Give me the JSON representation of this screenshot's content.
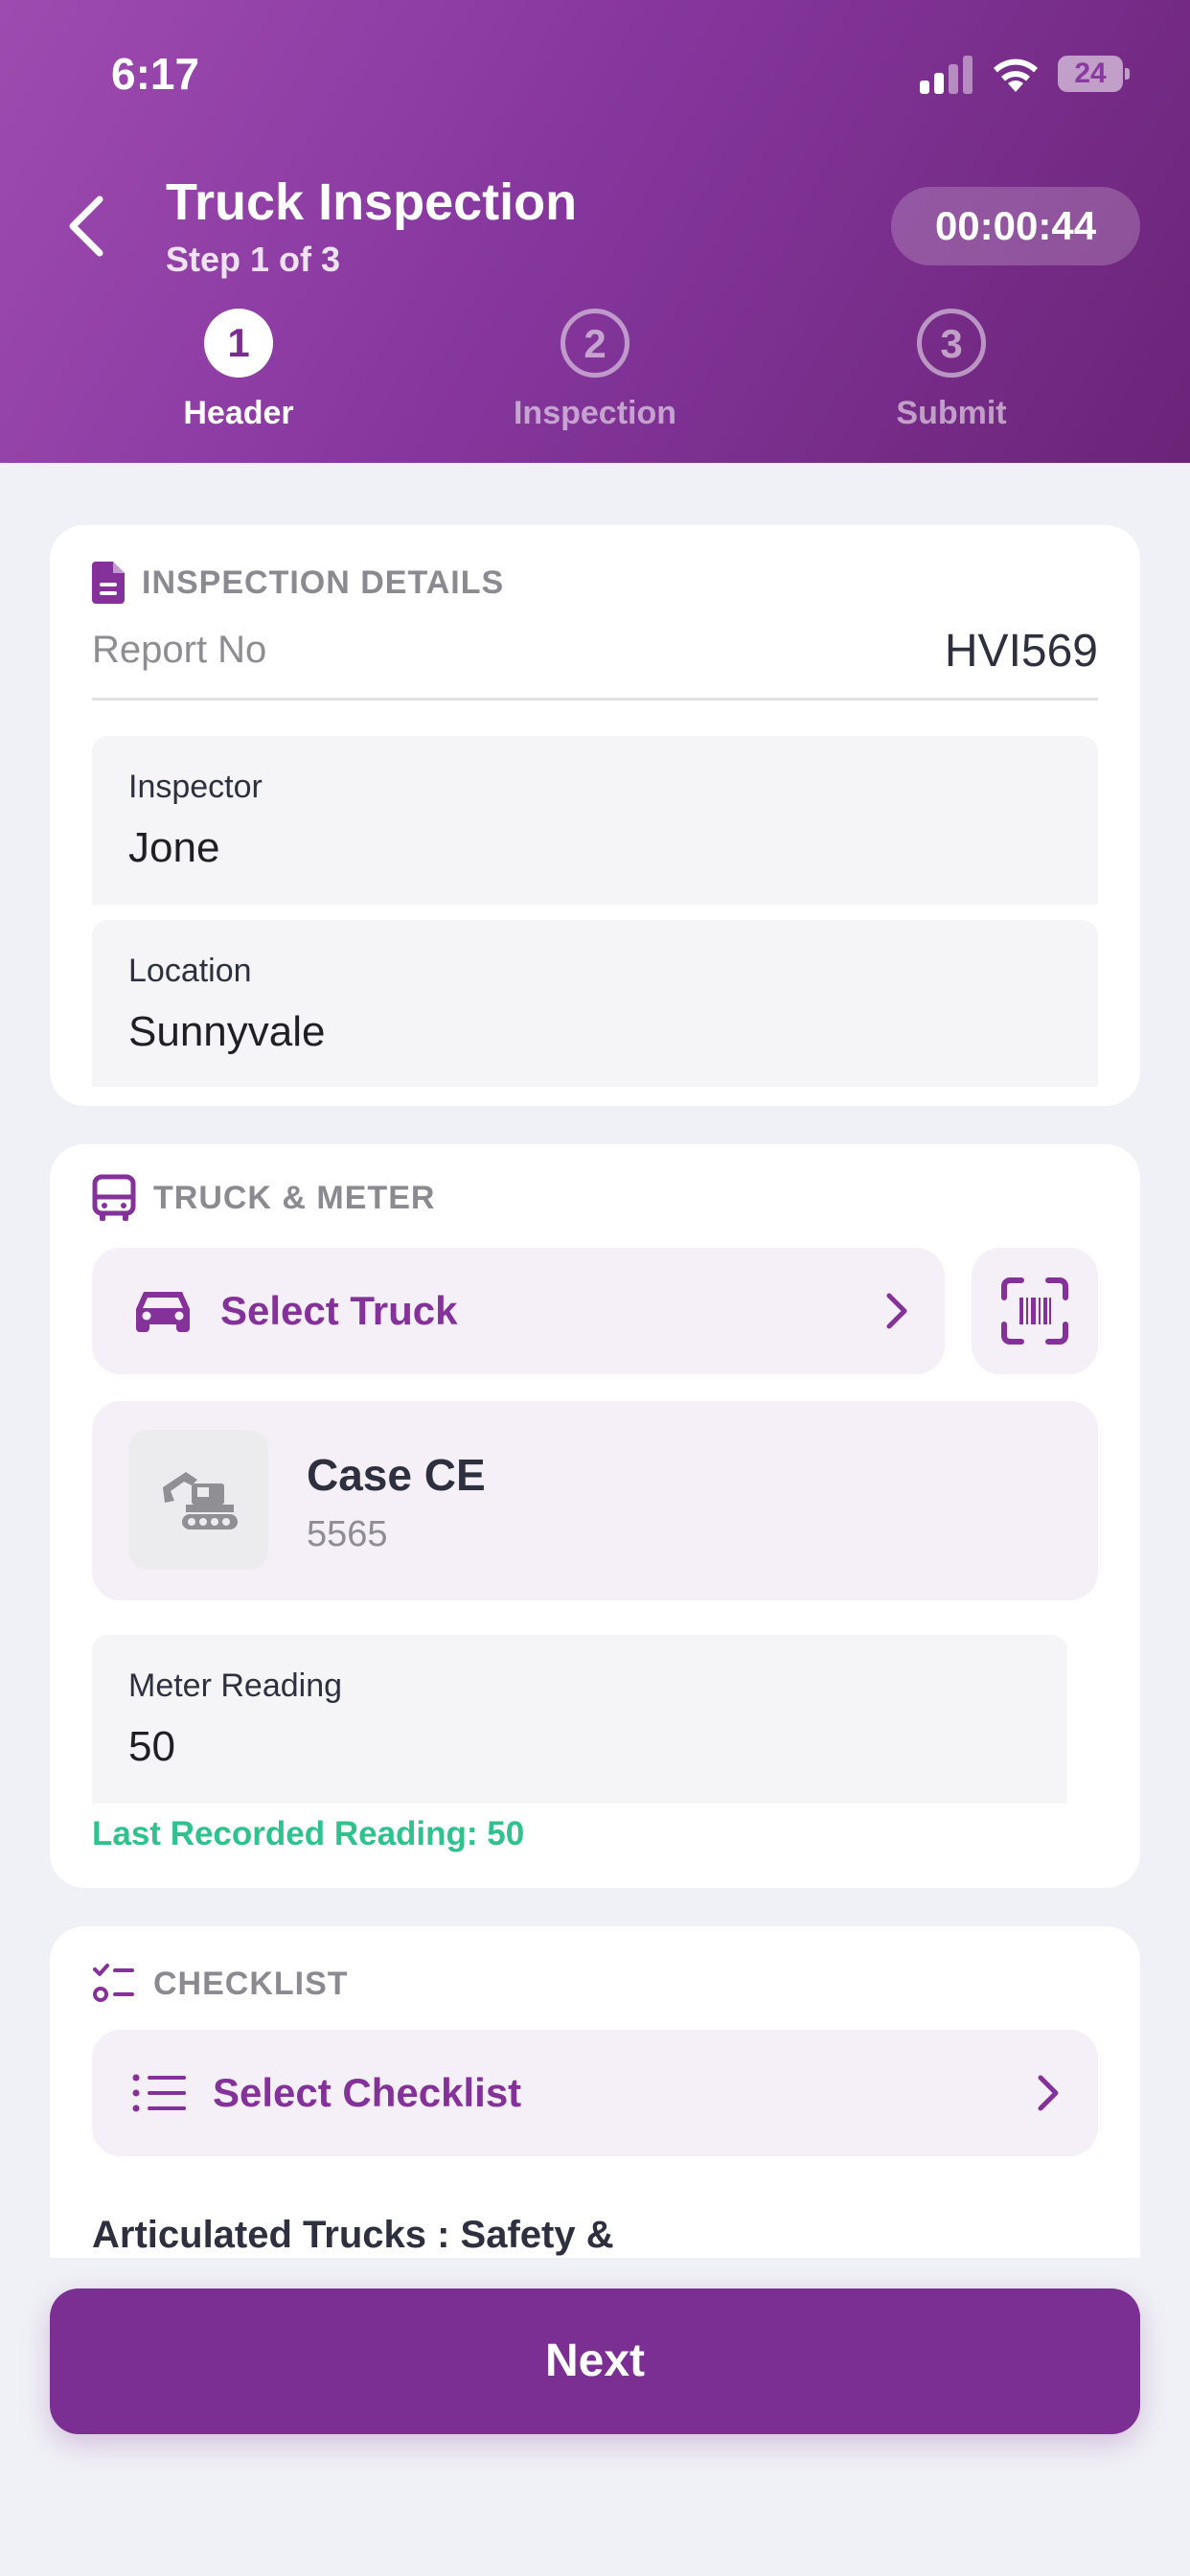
{
  "status_bar": {
    "time": "6:17",
    "battery": "24"
  },
  "header": {
    "title": "Truck Inspection",
    "subtitle": "Step 1 of 3",
    "timer": "00:00:44",
    "steps": [
      {
        "number": "1",
        "label": "Header",
        "active": true
      },
      {
        "number": "2",
        "label": "Inspection",
        "active": false
      },
      {
        "number": "3",
        "label": "Submit",
        "active": false
      }
    ]
  },
  "inspection_details": {
    "section_title": "INSPECTION DETAILS",
    "report_label": "Report No",
    "report_value": "HVI569",
    "inspector_label": "Inspector",
    "inspector_value": "Jone",
    "location_label": "Location",
    "location_value": "Sunnyvale"
  },
  "truck_meter": {
    "section_title": "TRUCK & METER",
    "select_truck_label": "Select Truck",
    "truck_name": "Case CE",
    "truck_id": "5565",
    "meter_label": "Meter Reading",
    "meter_value": "50",
    "last_reading": "Last Recorded Reading: 50"
  },
  "checklist": {
    "section_title": "CHECKLIST",
    "select_checklist_label": "Select Checklist",
    "selected_name": "Articulated Trucks : Safety &"
  },
  "footer": {
    "next_label": "Next"
  },
  "colors": {
    "primary": "#7c2f92",
    "accent_green": "#2fc18e",
    "tint": "#f5eff7"
  }
}
